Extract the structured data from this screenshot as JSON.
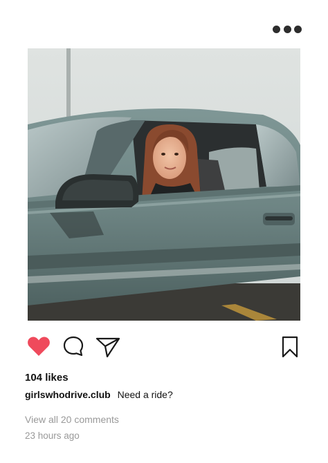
{
  "post": {
    "menu_icon": "more-horizontal-icon",
    "photo_alt": "Woman in a teal car",
    "actions": {
      "like_icon": "heart-icon",
      "like_color": "#ef4a5c",
      "comment_icon": "comment-icon",
      "share_icon": "send-icon",
      "bookmark_icon": "bookmark-icon"
    },
    "likes": "104 likes",
    "username": "girlswhodrive.club",
    "caption": "Need a ride?",
    "view_comments": "View all 20 comments",
    "timestamp": "23 hours ago"
  }
}
